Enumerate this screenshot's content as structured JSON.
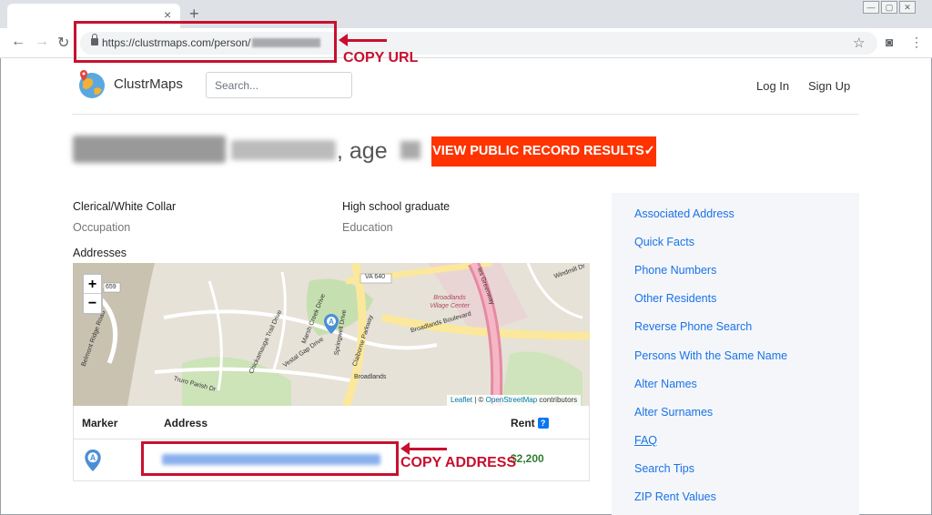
{
  "browser": {
    "tab_close": "×",
    "new_tab": "+",
    "url": "https://clustrmaps.com/person/",
    "window_controls": [
      "—",
      "▢",
      "✕"
    ]
  },
  "annotations": {
    "copy_url": "COPY URL",
    "copy_address": "COPY ADDRESS",
    "color": "#c8102e"
  },
  "header": {
    "brand": "ClustrMaps",
    "search_placeholder": "Search...",
    "login": "Log In",
    "signup": "Sign Up"
  },
  "title": {
    "age_label": ", age",
    "cta": "VIEW PUBLIC RECORD RESULTS✓",
    "cta_color": "#ff3300"
  },
  "facts": {
    "occupation_value": "Clerical/White Collar",
    "occupation_label": "Occupation",
    "education_value": "High school graduate",
    "education_label": "Education",
    "addresses_heading": "Addresses"
  },
  "map": {
    "zoom_in": "+",
    "zoom_out": "−",
    "attribution_leaflet": "Leaflet",
    "attribution_sep": " | © ",
    "attribution_osm": "OpenStreetMap",
    "attribution_tail": " contributors",
    "labels": {
      "va640": "VA 640",
      "r659": "659",
      "village": "Broadlands Village Center",
      "boulevard": "Broadlands Boulevard",
      "parkway": "Claiborne Parkway",
      "broadlands": "Broadlands",
      "belmont": "Belmont Ridge Road",
      "greenway": "les Greenway",
      "windmill": "Windmill Dr",
      "marsh": "Marsh Creek Drive",
      "vestal": "Vestal Gap Drive",
      "truro": "Truro Parish Dr",
      "ocheltree": "Chickamauga Trail Drive",
      "springwell": "Springwell Drive"
    }
  },
  "table": {
    "col_marker": "Marker",
    "col_address": "Address",
    "col_rent": "Rent",
    "help": "?",
    "marker_letter": "A",
    "rent_value": "$2,200"
  },
  "sidebar": {
    "items": [
      "Associated Address",
      "Quick Facts",
      "Phone Numbers",
      "Other Residents",
      "Reverse Phone Search",
      "Persons With the Same Name",
      "Alter Names",
      "Alter Surnames",
      "FAQ",
      "Search Tips",
      "ZIP Rent Values"
    ]
  }
}
